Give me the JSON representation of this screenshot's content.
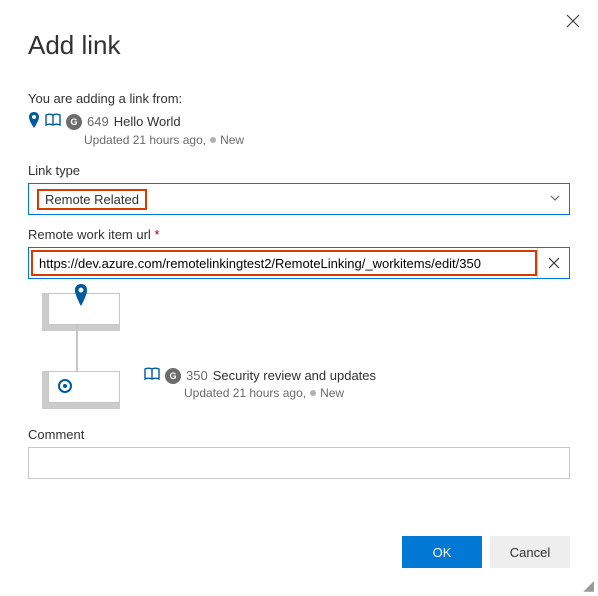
{
  "dialog": {
    "title": "Add link",
    "intro": "You are adding a link from:"
  },
  "source": {
    "id": "649",
    "title": "Hello World",
    "updated": "Updated 21 hours ago,",
    "state": "New"
  },
  "fields": {
    "linkTypeLabel": "Link type",
    "linkTypeValue": "Remote Related",
    "urlLabel": "Remote work item url",
    "urlRequired": "*",
    "urlValue": "https://dev.azure.com/remotelinkingtest2/RemoteLinking/_workitems/edit/350",
    "commentLabel": "Comment"
  },
  "linked": {
    "id": "350",
    "title": "Security review and updates",
    "updated": "Updated 21 hours ago,",
    "state": "New"
  },
  "actions": {
    "ok": "OK",
    "cancel": "Cancel"
  }
}
